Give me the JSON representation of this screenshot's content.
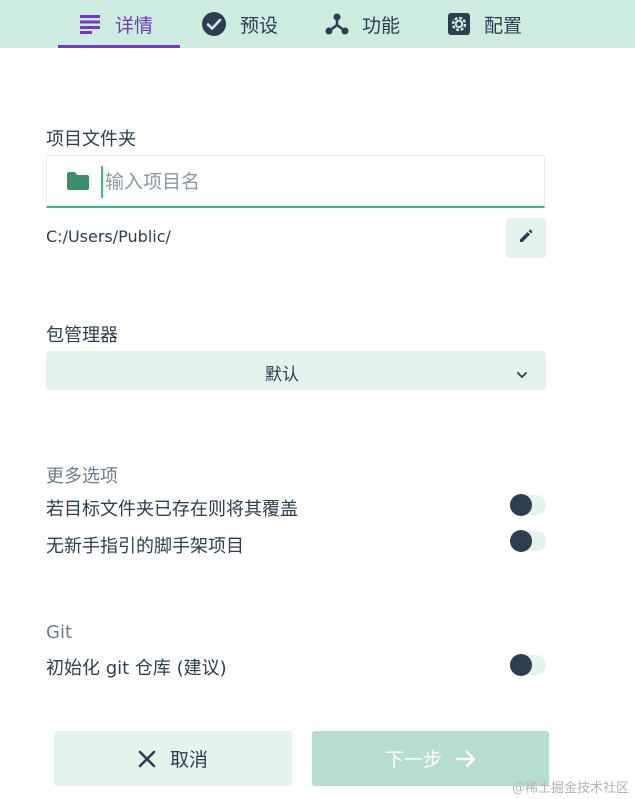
{
  "tabs": [
    {
      "label": "详情",
      "icon": "details-icon",
      "active": true
    },
    {
      "label": "预设",
      "icon": "check-circle-icon",
      "active": false
    },
    {
      "label": "功能",
      "icon": "fork-icon",
      "active": false
    },
    {
      "label": "配置",
      "icon": "gear-icon",
      "active": false
    }
  ],
  "project_folder": {
    "label": "项目文件夹",
    "placeholder": "输入项目名",
    "path": "C:/Users/Public/"
  },
  "package_manager": {
    "label": "包管理器",
    "selected": "默认"
  },
  "more_options": {
    "label": "更多选项",
    "options": [
      {
        "label": "若目标文件夹已存在则将其覆盖",
        "enabled": false
      },
      {
        "label": "无新手指引的脚手架项目",
        "enabled": false
      }
    ]
  },
  "git": {
    "label": "Git",
    "options": [
      {
        "label": "初始化 git 仓库 (建议)",
        "enabled": false
      }
    ]
  },
  "actions": {
    "cancel_label": "取消",
    "next_label": "下一步"
  },
  "watermark": "@稀土掘金技术社区",
  "colors": {
    "accent": "#7a35c9",
    "primary_green": "#42b983",
    "light_green_bg": "#e5f3ee",
    "tabbar_bg": "#cdebe1",
    "text": "#2c3e50"
  }
}
